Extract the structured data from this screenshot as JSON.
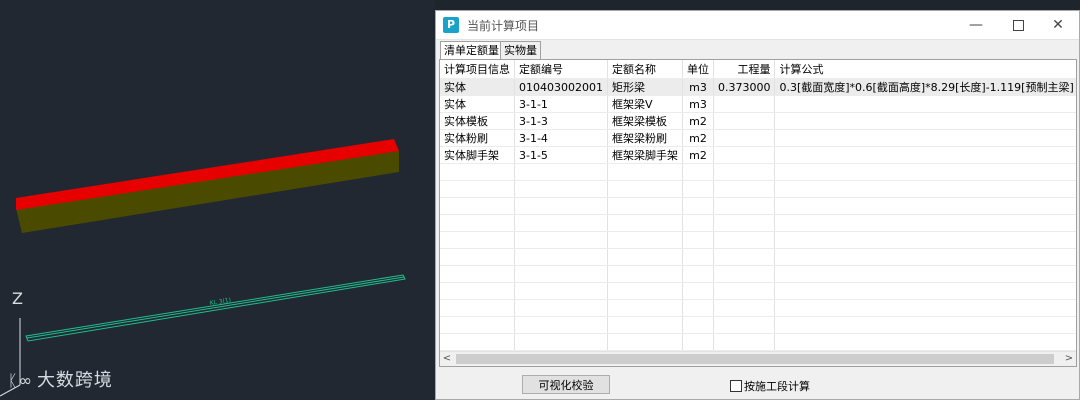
{
  "viewport": {
    "axis_label": "Z",
    "beam_label": "KL  3(1)",
    "watermark": "大数跨境",
    "colors": {
      "beam_top": "#e60000",
      "beam_side": "#4b4b00",
      "line": "#1fbf8f"
    }
  },
  "dialog": {
    "title": "当前计算项目",
    "app_icon": "P",
    "tabs": [
      {
        "label": "清单定额量",
        "active": true
      },
      {
        "label": "实物量",
        "active": false
      }
    ],
    "columns": [
      "计算项目信息",
      "定额编号",
      "定额名称",
      "单位",
      "工程量",
      "计算公式"
    ],
    "rows": [
      {
        "item": "实体",
        "code": "010403002001",
        "name": "矩形梁",
        "unit": "m3",
        "qty": "0.373000",
        "formula": "0.3[截面宽度]*0.6[截面高度]*8.29[长度]-1.119[预制主梁]"
      },
      {
        "item": "实体",
        "code": "3-1-1",
        "name": "框架梁V",
        "unit": "m3",
        "qty": "",
        "formula": ""
      },
      {
        "item": "实体模板",
        "code": "3-1-3",
        "name": "框架梁模板",
        "unit": "m2",
        "qty": "",
        "formula": ""
      },
      {
        "item": "实体粉刷",
        "code": "3-1-4",
        "name": "框架梁粉刷",
        "unit": "m2",
        "qty": "",
        "formula": ""
      },
      {
        "item": "实体脚手架",
        "code": "3-1-5",
        "name": "框架梁脚手架",
        "unit": "m2",
        "qty": "",
        "formula": ""
      }
    ],
    "footer": {
      "button_label": "可视化校验",
      "checkbox_label": "按施工段计算",
      "checkbox_checked": false
    }
  }
}
